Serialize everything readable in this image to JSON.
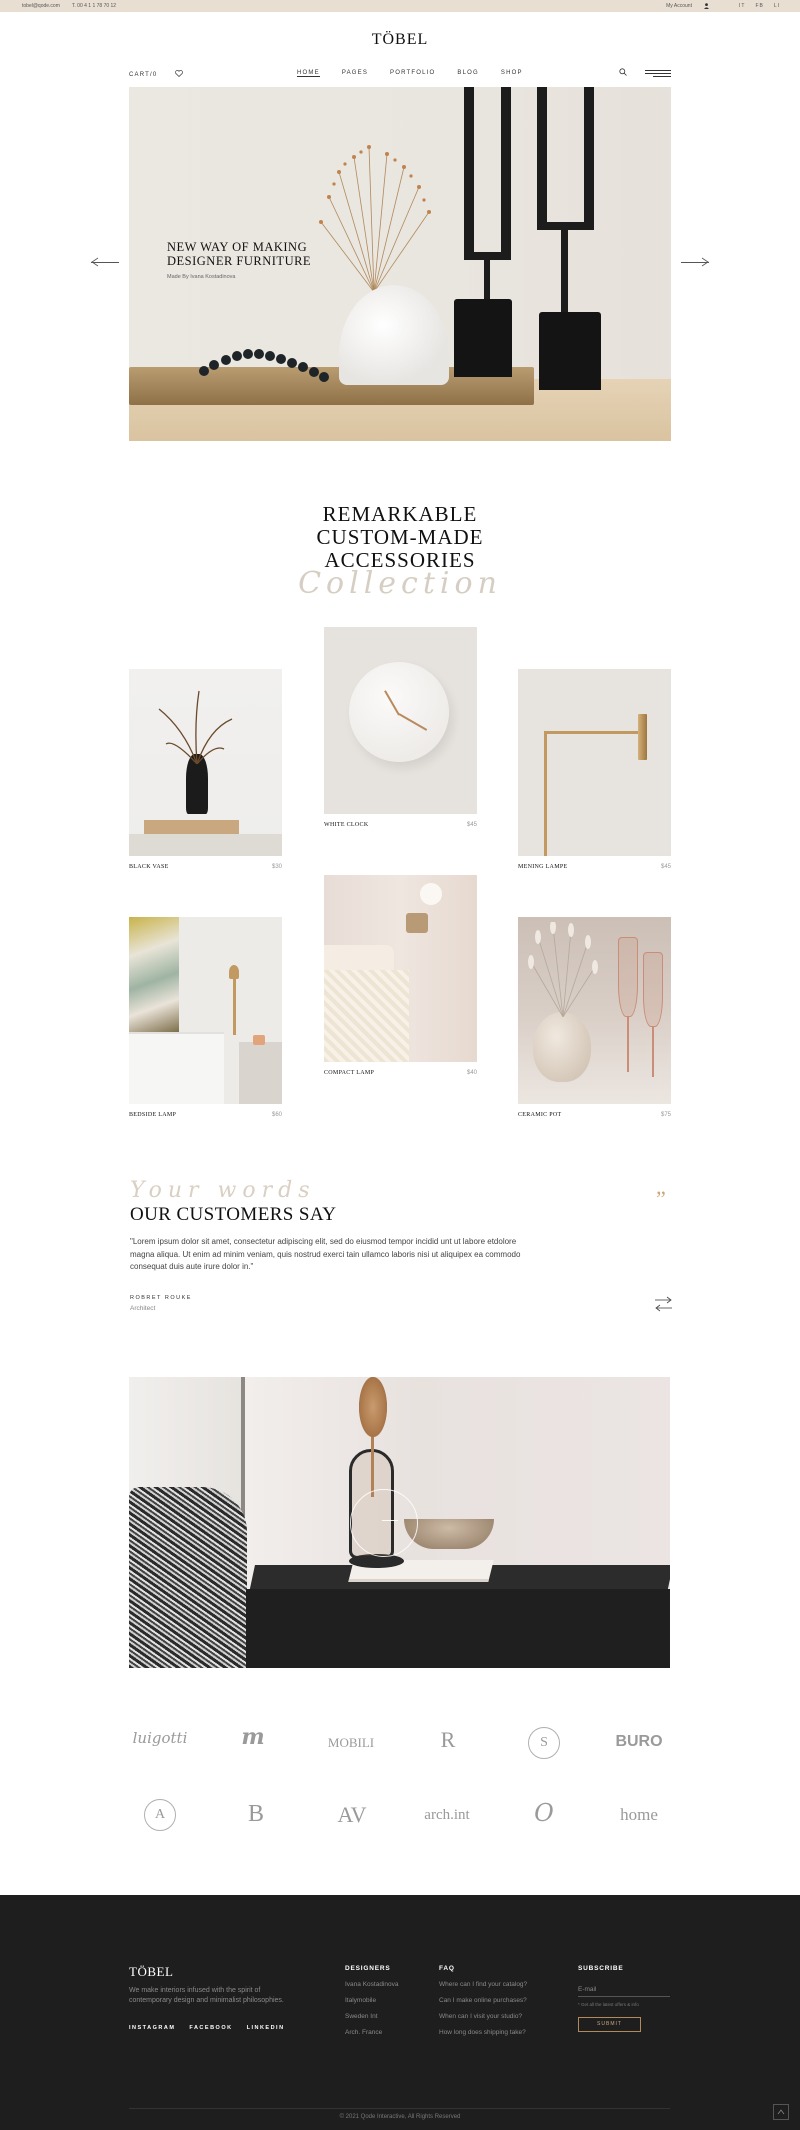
{
  "topbar": {
    "email": "tobel@qode.com",
    "phone": "T. 00 4 1 1 78 70 12",
    "account": "My Account",
    "langs": [
      "IT",
      "FB",
      "LI"
    ]
  },
  "header": {
    "logo": "TÖBEL",
    "cart": "CART/0",
    "nav": [
      "HOME",
      "PAGES",
      "PORTFOLIO",
      "BLOG",
      "SHOP"
    ]
  },
  "hero": {
    "title_line1": "NEW WAY OF MAKING",
    "title_line2": "DESIGNER FURNITURE",
    "subtitle": "Made By Ivana Kostadinova"
  },
  "collection": {
    "line1": "REMARKABLE",
    "line2": "CUSTOM-MADE",
    "line3": "ACCESSORIES",
    "script": "Collection"
  },
  "products": [
    {
      "name": "BLACK VASE",
      "price": "$30"
    },
    {
      "name": "WHITE CLOCK",
      "price": "$45"
    },
    {
      "name": "MENING LAMPE",
      "price": "$45"
    },
    {
      "name": "BEDSIDE LAMP",
      "price": "$60"
    },
    {
      "name": "COMPACT LAMP",
      "price": "$40"
    },
    {
      "name": "CERAMIC POT",
      "price": "$75"
    }
  ],
  "testimonial": {
    "script": "Your words",
    "title": "OUR CUSTOMERS SAY",
    "quote_mark": "”",
    "text": "\"Lorem ipsum dolor sit amet, consectetur adipiscing elit, sed do eiusmod tempor incidid unt ut labore etdolore magna aliqua. Ut enim ad minim veniam, quis nostrud exerci tain ullamco laboris nisi ut aliquipex ea commodo consequat duis aute irure dolor in.\"",
    "author": "ROBRET ROUKE",
    "role": "Architect"
  },
  "brands": [
    "luigotti",
    "m",
    "MOBILI",
    "R",
    "S",
    "BURO",
    "A",
    "B",
    "AV",
    "arch.int",
    "O",
    "home"
  ],
  "footer": {
    "logo": "TÖBEL",
    "about": "We make interiors infused with the spirit of contemporary design and minimalist philosophies.",
    "social": [
      "INSTAGRAM",
      "FACEBOOK",
      "LINKEDIN"
    ],
    "designers_title": "DESIGNERS",
    "designers": [
      "Ivana Kostadinova",
      "Italymobile",
      "Sweden Int",
      "Arch. France"
    ],
    "faq_title": "FAQ",
    "faq": [
      "Where can I find your catalog?",
      "Can I make online purchases?",
      "When can I visit your studio?",
      "How long does shipping take?"
    ],
    "subscribe_title": "SUBSCRIBE",
    "email_placeholder": "E-mail",
    "note": "* Get all the latest offers & info",
    "button": "SUBMIT",
    "copyright": "© 2021 Qode Interactive, All Rights Reserved"
  }
}
